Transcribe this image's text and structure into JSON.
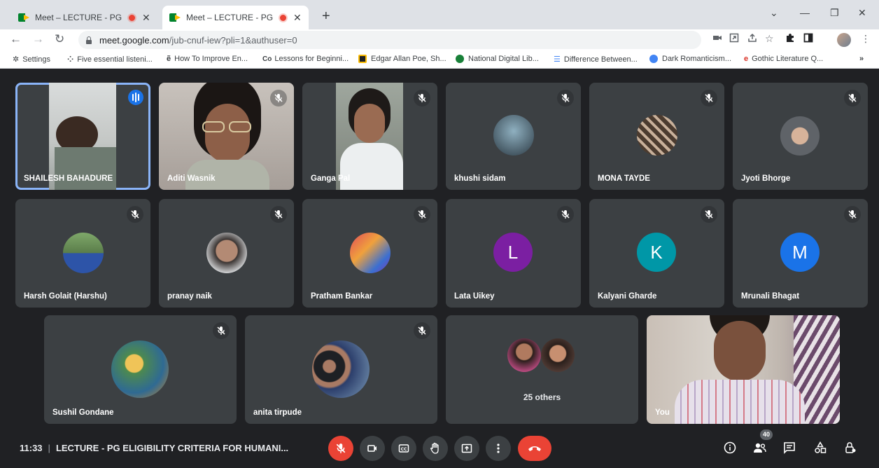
{
  "browser": {
    "tabs": [
      {
        "title": "Meet – LECTURE - PG ELIGIBILITY",
        "close": "✕"
      },
      {
        "title": "Meet – LECTURE - PG ELIGIBILITY",
        "close": "✕"
      }
    ],
    "new_tab": "+",
    "window_controls": [
      "⌄",
      "—",
      "❐",
      "✕"
    ],
    "url_domain": "meet.google.com",
    "url_path": "/jub-cnuf-iew?pli=1&authuser=0",
    "bookmarks": [
      {
        "label": "Settings",
        "color": "#5f6368"
      },
      {
        "label": "Five essential listeni...",
        "color": "#5f6368"
      },
      {
        "label": "How To Improve En...",
        "color": "#5f6368"
      },
      {
        "label": "Lessons for Beginni...",
        "color": "#3c4043"
      },
      {
        "label": "Edgar Allan Poe, Sh...",
        "color": "#b8860b"
      },
      {
        "label": "National Digital Lib...",
        "color": "#188038"
      },
      {
        "label": "Difference Between...",
        "color": "#4285f4"
      },
      {
        "label": "Dark Romanticism...",
        "color": "#4285f4"
      },
      {
        "label": "Gothic Literature Q...",
        "color": "#d93025"
      }
    ],
    "bookmarks_more": "»"
  },
  "participants": [
    {
      "name": "SHAILESH BAHADURE",
      "speaking": true
    },
    {
      "name": "Aditi Wasnik",
      "muted": true
    },
    {
      "name": "Ganga Pal",
      "muted": true
    },
    {
      "name": "khushi sidam",
      "muted": true
    },
    {
      "name": "MONA TAYDE",
      "muted": true
    },
    {
      "name": "Jyoti Bhorge",
      "muted": true
    },
    {
      "name": "Harsh Golait (Harshu)",
      "muted": true
    },
    {
      "name": "pranay naik",
      "muted": true
    },
    {
      "name": "Pratham Bankar",
      "muted": true
    },
    {
      "name": "Lata Uikey",
      "muted": true,
      "letter": "L",
      "color": "#7b1fa2"
    },
    {
      "name": "Kalyani Gharde",
      "muted": true,
      "letter": "K",
      "color": "#0097a7"
    },
    {
      "name": "Mrunali Bhagat",
      "muted": true,
      "letter": "M",
      "color": "#1a73e8"
    },
    {
      "name": "Sushil Gondane",
      "muted": true
    },
    {
      "name": "anita tirpude",
      "muted": true
    }
  ],
  "others_label": "25 others",
  "self_label": "You",
  "meeting": {
    "time": "11:33",
    "separator": "|",
    "title": "LECTURE - PG ELIGIBILITY CRITERIA FOR HUMANI...",
    "participant_count": "40"
  }
}
